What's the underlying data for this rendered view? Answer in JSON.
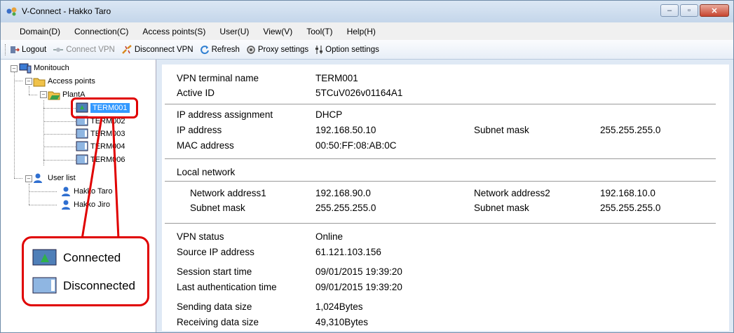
{
  "window": {
    "title": "V-Connect - Hakko Taro"
  },
  "menu": [
    "Domain(D)",
    "Connection(C)",
    "Access points(S)",
    "User(U)",
    "View(V)",
    "Tool(T)",
    "Help(H)"
  ],
  "toolbar": {
    "logout": "Logout",
    "connect_vpn": "Connect VPN",
    "disconnect_vpn": "Disconnect VPN",
    "refresh": "Refresh",
    "proxy": "Proxy settings",
    "option": "Option settings"
  },
  "tree": {
    "root": "Monitouch",
    "access_points": "Access points",
    "plant": "PlantA",
    "terminals": [
      "TERM001",
      "TERM002",
      "TERM003",
      "TERM004",
      "TERM006"
    ],
    "user_list": "User list",
    "users": [
      "Hakko Taro",
      "Hakko Jiro"
    ]
  },
  "detail": {
    "vpn_terminal_name": {
      "label": "VPN terminal name",
      "value": "TERM001"
    },
    "active_id": {
      "label": "Active ID",
      "value": "5TCuV026v01164A1"
    },
    "ip_assignment": {
      "label": "IP address assignment",
      "value": "DHCP"
    },
    "ip_address": {
      "label": "IP address",
      "value": "192.168.50.10"
    },
    "subnet_mask": {
      "label": "Subnet mask",
      "value": "255.255.255.0"
    },
    "mac_address": {
      "label": "MAC address",
      "value": "00:50:FF:08:AB:0C"
    },
    "local_network": "Local network",
    "net1": {
      "label": "Network address1",
      "value": "192.168.90.0"
    },
    "net2": {
      "label": "Network address2",
      "value": "192.168.10.0"
    },
    "mask1": {
      "label": "Subnet mask",
      "value": "255.255.255.0"
    },
    "mask2": {
      "label": "Subnet mask",
      "value": "255.255.255.0"
    },
    "vpn_status": {
      "label": "VPN status",
      "value": "Online"
    },
    "source_ip": {
      "label": "Source IP address",
      "value": "61.121.103.156"
    },
    "session_start": {
      "label": "Session start time",
      "value": "09/01/2015 19:39:20"
    },
    "last_auth": {
      "label": "Last authentication time",
      "value": "09/01/2015 19:39:20"
    },
    "sending": {
      "label": "Sending data size",
      "value": "1,024Bytes"
    },
    "receiving": {
      "label": "Receiving data size",
      "value": "49,310Bytes"
    }
  },
  "legend": {
    "connected": "Connected",
    "disconnected": "Disconnected"
  },
  "colors": {
    "highlight": "#e00000",
    "selection": "#3399ff"
  }
}
